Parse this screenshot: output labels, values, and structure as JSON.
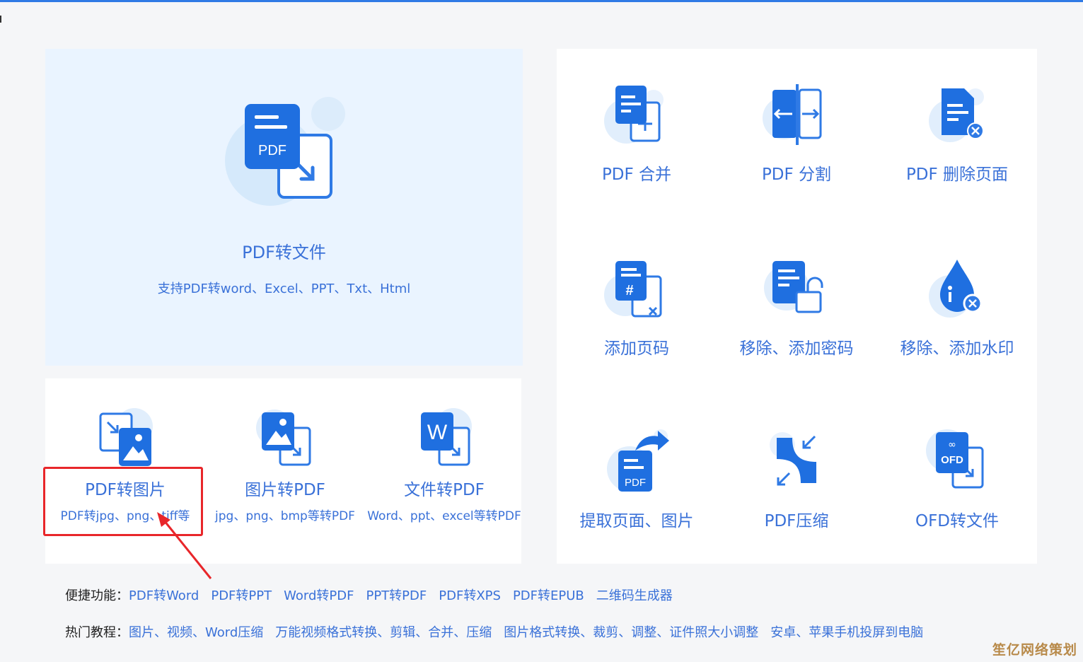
{
  "main_tool": {
    "title": "PDF转文件",
    "subtitle": "支持PDF转word、Excel、PPT、Txt、Html",
    "icon_text": "PDF"
  },
  "small_tools": [
    {
      "title": "PDF转图片",
      "subtitle": "PDF转jpg、png、tiff等"
    },
    {
      "title": "图片转PDF",
      "subtitle": "jpg、png、bmp等转PDF"
    },
    {
      "title": "文件转PDF",
      "subtitle": "Word、ppt、excel等转PDF",
      "icon_text": "W"
    }
  ],
  "right_tools": [
    {
      "title": "PDF 合并"
    },
    {
      "title": "PDF 分割"
    },
    {
      "title": "PDF 删除页面"
    },
    {
      "title": "添加页码"
    },
    {
      "title": "移除、添加密码"
    },
    {
      "title": "移除、添加水印"
    },
    {
      "title": "提取页面、图片",
      "icon_text": "PDF"
    },
    {
      "title": "PDF压缩"
    },
    {
      "title": "OFD转文件",
      "icon_text": "OFD"
    }
  ],
  "quick_links": {
    "label": "便捷功能：",
    "items": [
      "PDF转Word",
      "PDF转PPT",
      "Word转PDF",
      "PPT转PDF",
      "PDF转XPS",
      "PDF转EPUB",
      "二维码生成器"
    ]
  },
  "tutorials": {
    "label": "热门教程：",
    "items": [
      "图片、视频、Word压缩",
      "万能视频格式转换、剪辑、合并、压缩",
      "图片格式转换、裁剪、调整、证件照大小调整",
      "安卓、苹果手机投屏到电脑"
    ]
  },
  "watermark": "笙亿网络策划",
  "colors": {
    "accent": "#2f7ae5",
    "icon_dark": "#1f6fe0",
    "text_blue": "#3a71d8",
    "highlight_red": "#e8262a",
    "panel_bg": "#eaf4ff"
  }
}
